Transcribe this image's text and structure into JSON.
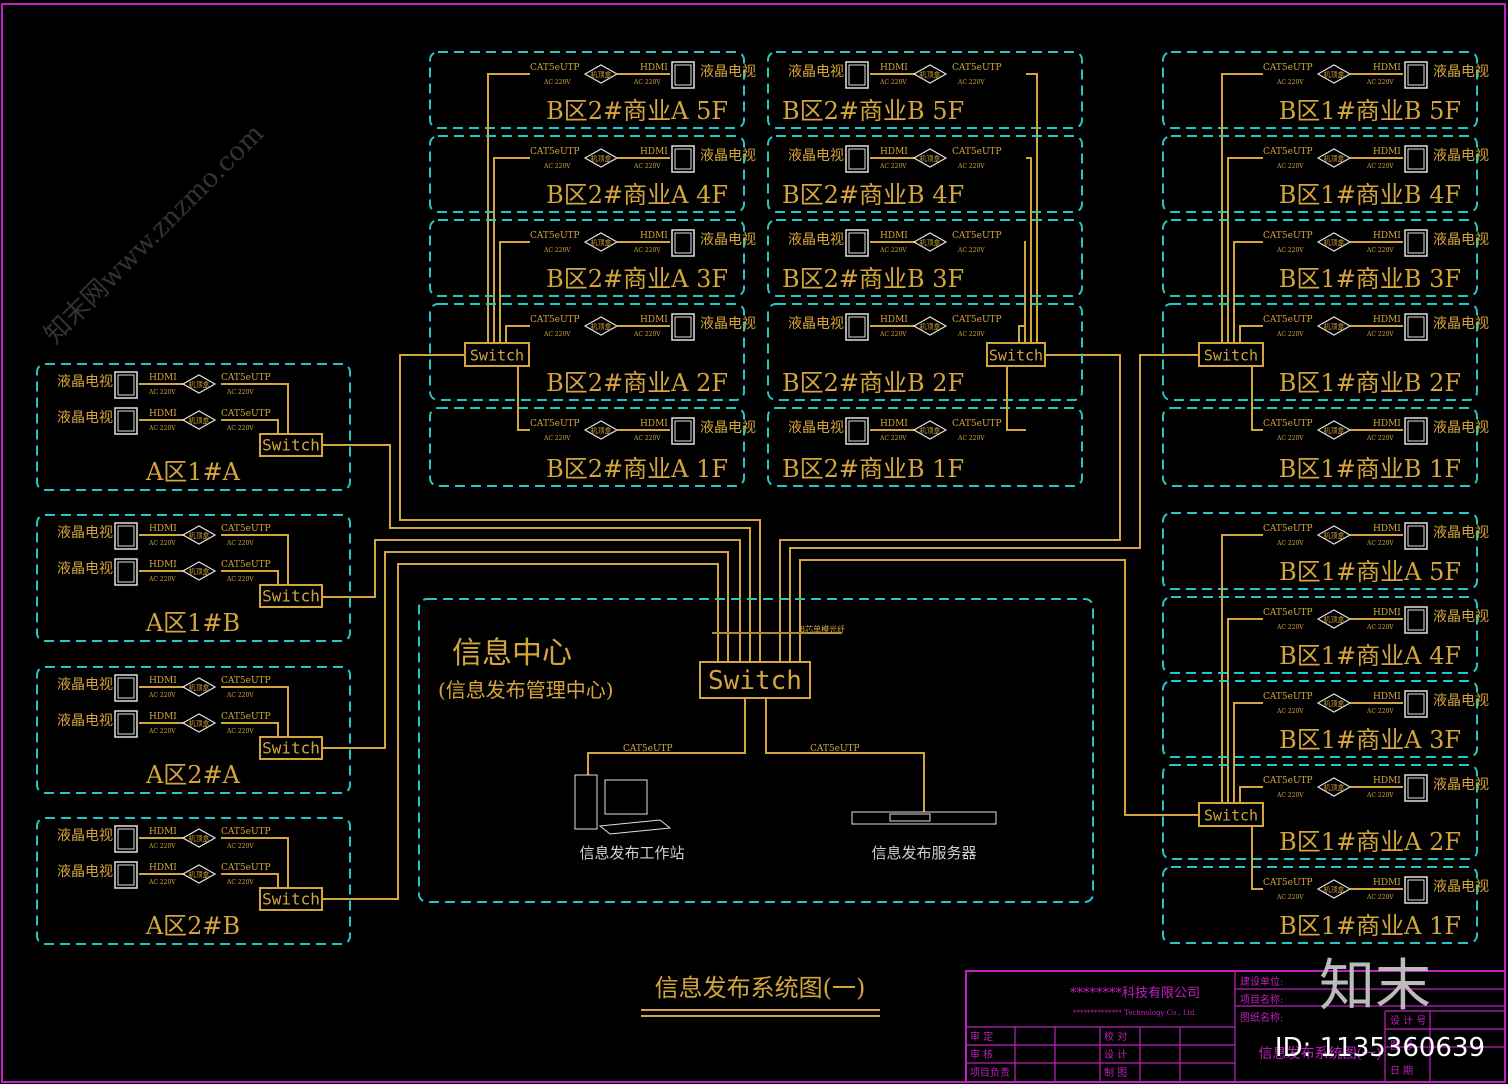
{
  "colors": {
    "line": "#d4a53a",
    "box": "#25c6c6",
    "frame": "#c020c0",
    "text": "#d4a53a",
    "device": "#e0e0e0"
  },
  "device_labels": {
    "tv": "液晶电视",
    "hdmi": "HDMI",
    "cable": "CAT5eUTP",
    "power": "AC 220V",
    "player": "机顶盒",
    "switch": "Switch"
  },
  "zones_b_col1": [
    "B区2#商业A 5F",
    "B区2#商业A 4F",
    "B区2#商业A 3F",
    "B区2#商业A 2F",
    "B区2#商业A 1F"
  ],
  "zones_b_col2": [
    "B区2#商业B 5F",
    "B区2#商业B 4F",
    "B区2#商业B 3F",
    "B区2#商业B 2F",
    "B区2#商业B 1F"
  ],
  "zones_b_col3_top": [
    "B区1#商业B 5F",
    "B区1#商业B 4F",
    "B区1#商业B 3F",
    "B区1#商业B 2F",
    "B区1#商业B 1F"
  ],
  "zones_b_col3_bottom": [
    "B区1#商业A 5F",
    "B区1#商业A 4F",
    "B区1#商业A 3F",
    "B区1#商业A 2F",
    "B区1#商业A 1F"
  ],
  "zones_a": [
    "A区1#A",
    "A区1#B",
    "A区2#A",
    "A区2#B"
  ],
  "center": {
    "title": "信息中心",
    "subtitle": "(信息发布管理中心)",
    "switch": "Switch",
    "fiber_label": "8芯单模光纤",
    "cable_left": "CAT5eUTP",
    "cable_right": "CAT5eUTP",
    "workstation": "信息发布工作站",
    "server": "信息发布服务器"
  },
  "drawing_title": "信息发布系统图(一)",
  "title_block": {
    "company": "********科技有限公司",
    "company_en": "************** Technology Co., Ltd.",
    "labels_left": [
      "审 定",
      "审 核",
      "项目负责"
    ],
    "labels_mid": [
      "校 对",
      "设 计",
      "制 图"
    ],
    "labels_right": [
      "建设单位:",
      "项目名称:",
      "图纸名称:"
    ],
    "drawing_name": "信息发布系统图(一)",
    "labels_far": [
      "设 计 号",
      "图 号",
      "日 期"
    ]
  },
  "watermark": {
    "site": "知末网www.znzmo.com",
    "brand": "知末",
    "id": "ID: 1135360639"
  }
}
